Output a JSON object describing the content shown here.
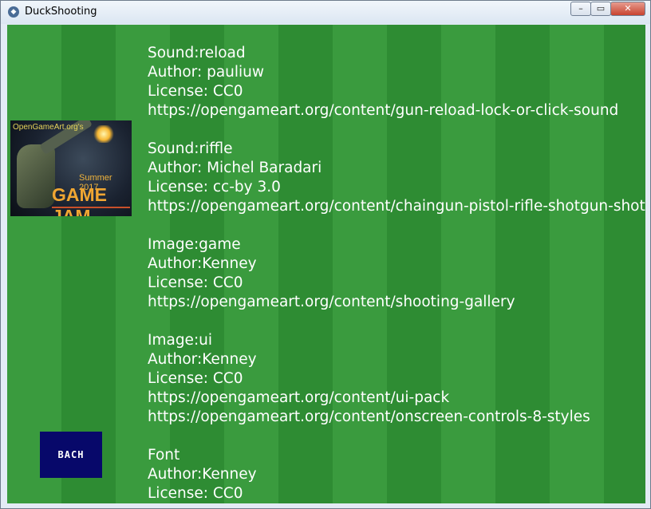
{
  "window": {
    "title": "DuckShooting",
    "minimize_label": "–",
    "restore_label": "▭",
    "close_label": "✕"
  },
  "game_jam_logo": {
    "top_text": "OpenGameArt.org's",
    "summer_text": "Summer 2017",
    "title_text": "GAME JAM"
  },
  "credits": [
    [
      "Sound:reload",
      "Author: pauliuw",
      "License: CC0",
      "https://opengameart.org/content/gun-reload-lock-or-click-sound"
    ],
    [
      "Sound:riffle",
      "Author: Michel Baradari",
      "License: cc-by 3.0",
      "https://opengameart.org/content/chaingun-pistol-rifle-shotgun-shots"
    ],
    [
      "Image:game",
      "Author:Kenney",
      "License: CC0",
      "https://opengameart.org/content/shooting-gallery"
    ],
    [
      "Image:ui",
      "Author:Kenney",
      "License: CC0",
      "https://opengameart.org/content/ui-pack",
      "https://opengameart.org/content/onscreen-controls-8-styles"
    ],
    [
      "Font",
      "Author:Kenney",
      "License: CC0"
    ]
  ],
  "back_button": {
    "label": "BACH"
  },
  "colors": {
    "grass_light": "#3a9b3e",
    "grass_dark": "#2e8c33",
    "button_bg": "#07086a"
  }
}
